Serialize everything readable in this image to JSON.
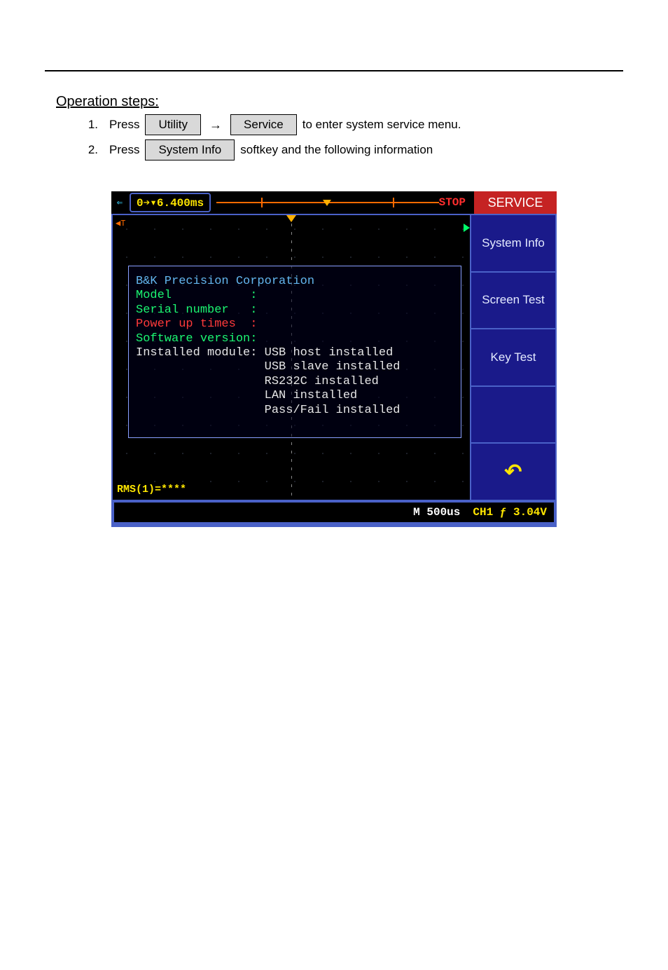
{
  "page": {
    "steps_heading": "Operation steps:",
    "step1_num": "1.",
    "step1_prefix": "Press",
    "utility_btn": "Utility",
    "arrow": "→",
    "service_btn": "Service",
    "step1_suffix": "to enter system service menu.",
    "step2_num": "2.",
    "step2_prefix": "Press",
    "sysinfo_btn": "System Info",
    "step2_suffix": "softkey and the following information"
  },
  "scope": {
    "tpos": "0➔▾6.400ms",
    "stop": "STOP",
    "service_title": "SERVICE",
    "softkeys": [
      "System Info",
      "Screen Test",
      "Key Test",
      "",
      "back"
    ],
    "info": {
      "company": "B&K Precision Corporation",
      "model_label": "Model           :",
      "serial_label": "Serial number   :",
      "power_label": "Power up times  :",
      "swver_label": "Software version:",
      "inst_label": "Installed module:",
      "inst_lines": [
        "USB host installed",
        "USB slave installed",
        "RS232C installed",
        "LAN installed",
        "Pass/Fail installed"
      ]
    },
    "rms": "RMS(1)=****",
    "timebase": "M 500us",
    "trigger": "CH1 ƒ 3.04V"
  }
}
